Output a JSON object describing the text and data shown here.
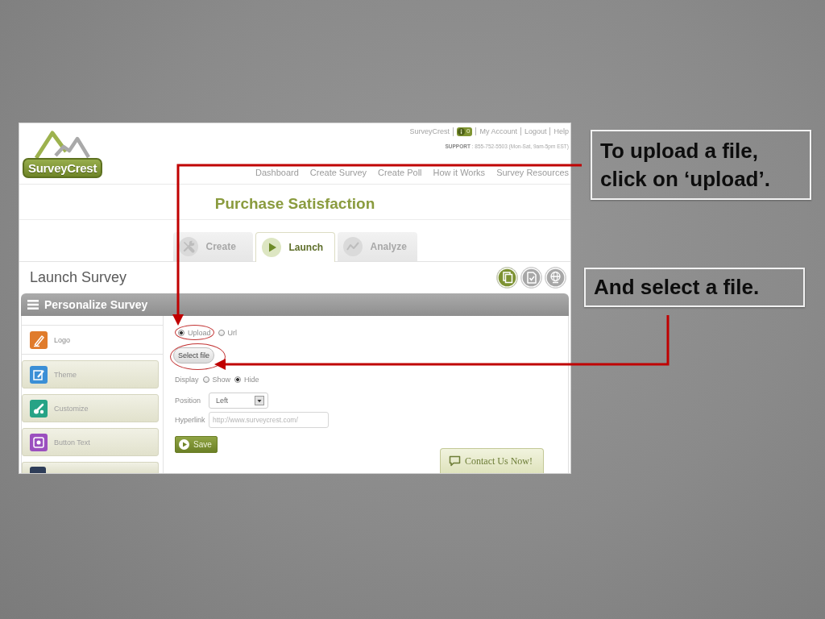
{
  "header": {
    "logo": {
      "text": "SurveyCrest"
    },
    "top_links": [
      {
        "kind": "link",
        "label": "SurveyCrest"
      },
      {
        "kind": "badge",
        "count": "0"
      },
      {
        "kind": "link",
        "label": "My Account"
      },
      {
        "kind": "link",
        "label": "Logout"
      },
      {
        "kind": "link",
        "label": "Help"
      }
    ],
    "support": "**SUPPORT** : 855-752-5503 (Mon-Sat, 9am-5pm EST)",
    "nav": [
      "Dashboard",
      "Create Survey",
      "Create Poll",
      "How it Works",
      "Survey Resources"
    ]
  },
  "survey_title": "Purchase Satisfaction",
  "tabs": [
    {
      "label": "Create",
      "selected": false
    },
    {
      "label": "Launch",
      "selected": true
    },
    {
      "label": "Analyze",
      "selected": false
    }
  ],
  "section": {
    "title": "Launch Survey",
    "actions": [
      {
        "selected": true
      },
      {
        "selected": false
      },
      {
        "selected": false
      }
    ]
  },
  "panel": {
    "title": "Personalize Survey"
  },
  "sidebar": {
    "items": [
      {
        "label": "Logo",
        "color": "#e07b2b",
        "selected": true
      },
      {
        "label": "Theme",
        "color": "#3b8fd6",
        "selected": false
      },
      {
        "label": "Customize",
        "color": "#27a386",
        "selected": false
      },
      {
        "label": "Button Text",
        "color": "#9b4fbf",
        "selected": false
      },
      {
        "color": "#2e3d58",
        "selected": false
      }
    ]
  },
  "form": {
    "source": [
      {
        "label": "Upload",
        "selected": true,
        "highlighted": true
      },
      {
        "label": "Url",
        "selected": false,
        "highlighted": false
      }
    ],
    "select_button": {
      "label": "Select file",
      "highlighted": true
    },
    "display": {
      "label": "Display",
      "options": [
        {
          "label": "Show",
          "selected": false
        },
        {
          "label": "Hide",
          "selected": true
        }
      ]
    },
    "position": {
      "label": "Position",
      "value": "Left"
    },
    "hyperlink": {
      "label": "Hyperlink",
      "placeholder": "http://www.surveycrest.com/"
    },
    "save_button": {
      "label": "Save"
    }
  },
  "contact_tab": {
    "label": "Contact Us Now!"
  },
  "callouts": [
    {
      "text": "To upload a file, click on ‘upload’."
    },
    {
      "text": "And select a file."
    }
  ]
}
